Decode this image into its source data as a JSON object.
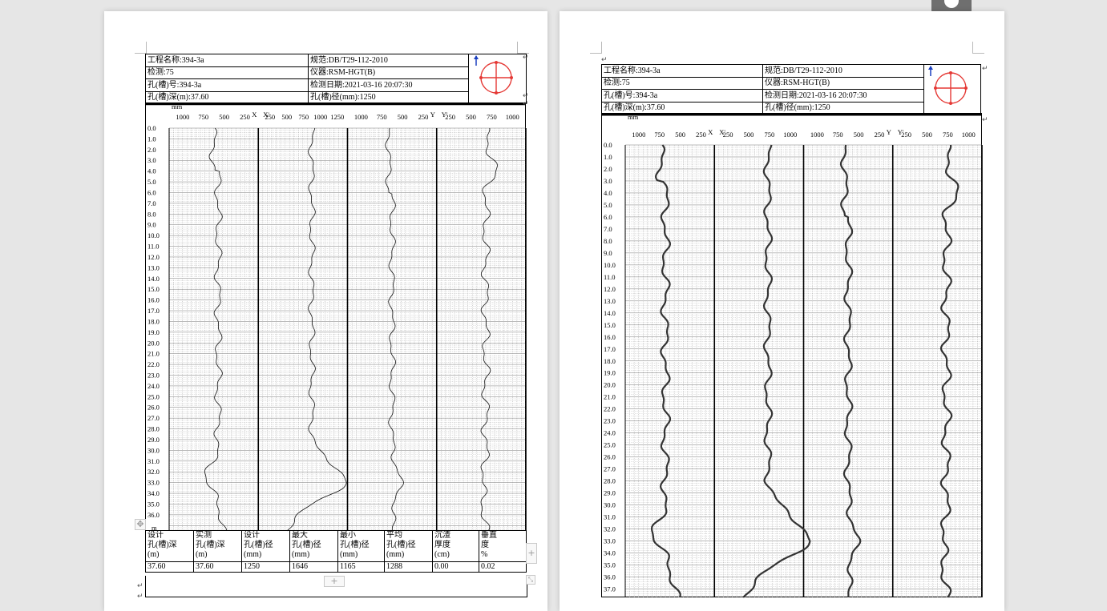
{
  "header_fields": {
    "project_name": "工程名称:394-3a",
    "standard": "规范:DB/T29-112-2010",
    "detection": "检测:75",
    "instrument": "仪器:RSM-HGT(B)",
    "hole_no": "孔(槽)号:394-3a",
    "test_date": "检测日期:2021-03-16 20:07:30",
    "hole_depth": "孔(槽)深(m):37.60",
    "hole_diameter": "孔(槽)径(mm):1250"
  },
  "compass": {
    "x": "X",
    "x_prime": "X'",
    "y": "Y",
    "y_prime": "Y'",
    "north": "北",
    "color": "#e53935"
  },
  "plot": {
    "unit_label": "mm",
    "top_ticks": [
      [
        "1000",
        "750",
        "500",
        "250"
      ],
      [
        "250",
        "500",
        "750",
        "1000",
        "1250"
      ],
      [
        "1000",
        "750",
        "500",
        "250"
      ],
      [
        "250",
        "500",
        "750",
        "1000"
      ]
    ],
    "axis_letters": [
      "X",
      "X'",
      "Y",
      "Y'"
    ],
    "depth_labels": [
      "0.0",
      "1.0",
      "2.0",
      "3.0",
      "4.0",
      "5.0",
      "6.0",
      "7.0",
      "8.0",
      "9.0",
      "10.0",
      "11.0",
      "12.0",
      "13.0",
      "14.0",
      "15.0",
      "16.0",
      "17.0",
      "18.0",
      "19.0",
      "20.0",
      "21.0",
      "22.0",
      "23.0",
      "24.0",
      "25.0",
      "26.0",
      "27.0",
      "28.0",
      "29.0",
      "30.0",
      "31.0",
      "32.0",
      "33.0",
      "34.0",
      "35.0",
      "36.0"
    ],
    "depth_unit": "m"
  },
  "page2_plot": {
    "top_ticks": [
      [
        "1000",
        "750",
        "500",
        "250"
      ],
      [
        "250",
        "500",
        "750",
        "1000"
      ],
      [
        "1000",
        "750",
        "500",
        "250"
      ],
      [
        "250",
        "500",
        "750",
        "1000"
      ]
    ],
    "depth_labels": [
      "0.0",
      "1.0",
      "2.0",
      "3.0",
      "4.0",
      "5.0",
      "6.0",
      "7.0",
      "8.0",
      "9.0",
      "10.0",
      "11.0",
      "12.0",
      "13.0",
      "14.0",
      "15.0",
      "16.0",
      "17.0",
      "18.0",
      "19.0",
      "20.0",
      "21.0",
      "22.0",
      "23.0",
      "24.0",
      "25.0",
      "26.0",
      "27.0",
      "28.0",
      "29.0",
      "30.0",
      "31.0",
      "32.0",
      "33.0",
      "34.0",
      "35.0",
      "36.0",
      "37.0"
    ]
  },
  "summary": {
    "headers": [
      [
        "设计",
        "孔(槽)深",
        "(m)"
      ],
      [
        "实测",
        "孔(槽)深",
        "(m)"
      ],
      [
        "设计",
        "孔(槽)径",
        "(mm)"
      ],
      [
        "最大",
        "孔(槽)径",
        "(mm)"
      ],
      [
        "最小",
        "孔(槽)径",
        "(mm)"
      ],
      [
        "平均",
        "孔(槽)径",
        "(mm)"
      ],
      [
        "沉渣",
        "厚度",
        "(cm)"
      ],
      [
        "垂直",
        "度",
        "%"
      ]
    ],
    "values": [
      "37.60",
      "37.60",
      "1250",
      "1646",
      "1165",
      "1288",
      "0.00",
      "0.02"
    ]
  },
  "ui": {
    "add_row": "+",
    "add_col": "+",
    "doc_icon": "document-icon"
  }
}
